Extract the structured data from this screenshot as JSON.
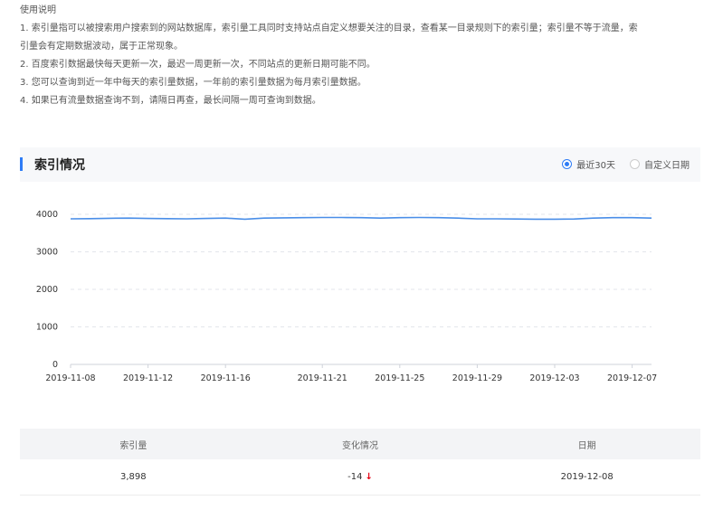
{
  "instructions": {
    "title": "使用说明",
    "lines": [
      "1. 索引量指可以被搜索用户搜索到的网站数据库，索引量工具同时支持站点自定义想要关注的目录，查看某一目录规则下的索引量；索引量不等于流量，索",
      "引量会有定期数据波动，属于正常现象。",
      "2. 百度索引数据最快每天更新一次，最迟一周更新一次，不同站点的更新日期可能不同。",
      "3. 您可以查询到近一年中每天的索引量数据，一年前的索引量数据为每月索引量数据。",
      "4. 如果已有流量数据查询不到，请隔日再查，最长间隔一周可查询到数据。"
    ]
  },
  "section": {
    "title": "索引情况",
    "range_options": [
      {
        "label": "最近30天",
        "checked": true
      },
      {
        "label": "自定义日期",
        "checked": false
      }
    ]
  },
  "chart_data": {
    "type": "line",
    "x": [
      "2019-11-08",
      "2019-11-09",
      "2019-11-10",
      "2019-11-11",
      "2019-11-12",
      "2019-11-13",
      "2019-11-14",
      "2019-11-15",
      "2019-11-16",
      "2019-11-17",
      "2019-11-18",
      "2019-11-19",
      "2019-11-20",
      "2019-11-21",
      "2019-11-22",
      "2019-11-23",
      "2019-11-24",
      "2019-11-25",
      "2019-11-26",
      "2019-11-27",
      "2019-11-28",
      "2019-11-29",
      "2019-11-30",
      "2019-12-01",
      "2019-12-02",
      "2019-12-03",
      "2019-12-04",
      "2019-12-05",
      "2019-12-06",
      "2019-12-07",
      "2019-12-08"
    ],
    "series": [
      {
        "values": [
          3880,
          3885,
          3895,
          3900,
          3890,
          3885,
          3880,
          3890,
          3900,
          3870,
          3900,
          3905,
          3910,
          3915,
          3915,
          3910,
          3900,
          3910,
          3915,
          3910,
          3900,
          3880,
          3880,
          3875,
          3870,
          3870,
          3875,
          3900,
          3910,
          3912,
          3898
        ],
        "color": "#4a8ee8"
      }
    ],
    "x_tick_labels": [
      "2019-11-08",
      "2019-11-12",
      "2019-11-16",
      "2019-11-21",
      "2019-11-25",
      "2019-11-29",
      "2019-12-03",
      "2019-12-07"
    ],
    "y_ticks": [
      0,
      1000,
      2000,
      3000,
      4000
    ],
    "ylim": [
      0,
      4000
    ],
    "grid": "horizontal dashed",
    "title": "",
    "xlabel": "",
    "ylabel": ""
  },
  "table": {
    "headers": [
      "索引量",
      "变化情况",
      "日期"
    ],
    "rows": [
      {
        "count": "3,898",
        "change": "-14",
        "date": "2019-12-08"
      }
    ],
    "down_arrow": "↓",
    "down_color": "#e60012"
  }
}
